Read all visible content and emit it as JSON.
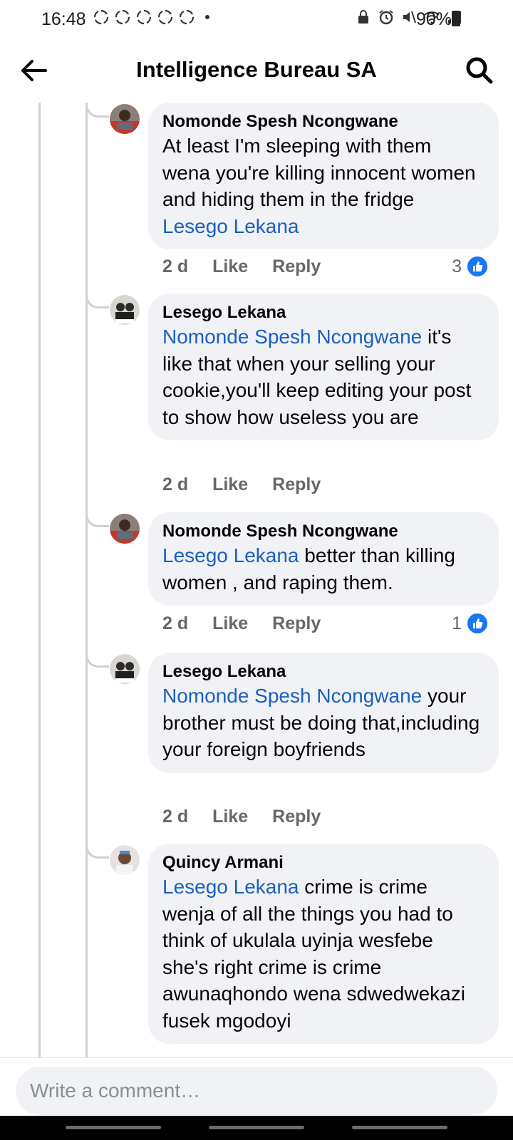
{
  "status_bar": {
    "time": "16:48",
    "battery": "90%"
  },
  "header": {
    "title": "Intelligence Bureau SA"
  },
  "comments": [
    {
      "author": "Nomonde Spesh Ncongwane",
      "text_before": "At least I'm sleeping with them wena you're killing innocent women and hiding them in the fridge ",
      "mention": "Lesego Lekana",
      "text_after": "",
      "time": "2 d",
      "like_label": "Like",
      "reply_label": "Reply",
      "reaction_count": "3"
    },
    {
      "author": "Lesego Lekana",
      "text_before": "",
      "mention": "Nomonde Spesh Ncongwane",
      "text_after": " it's like that when your selling your cookie,you'll keep editing your post to show how useless you are",
      "time": "2 d",
      "like_label": "Like",
      "reply_label": "Reply",
      "reaction_count": ""
    },
    {
      "author": "Nomonde Spesh Ncongwane",
      "text_before": "",
      "mention": "Lesego Lekana",
      "text_after": " better than killing women , and raping them.",
      "time": "2 d",
      "like_label": "Like",
      "reply_label": "Reply",
      "reaction_count": "1"
    },
    {
      "author": "Lesego Lekana",
      "text_before": "",
      "mention": "Nomonde Spesh Ncongwane",
      "text_after": " your brother must be doing that,including your foreign boyfriends",
      "time": "2 d",
      "like_label": "Like",
      "reply_label": "Reply",
      "reaction_count": ""
    },
    {
      "author": "Quincy Armani",
      "text_before": "",
      "mention": "Lesego Lekana",
      "text_after": " crime is crime wenja of all the things you had to think of ukulala uyinja wesfebe she's right crime is crime awunaqhondo wena sdwedwekazi fusek mgodoyi",
      "time": "",
      "like_label": "",
      "reply_label": "",
      "reaction_count": ""
    }
  ],
  "composer": {
    "placeholder": "Write a comment…"
  },
  "colors": {
    "mention": "#1b5fc1",
    "bubble": "#f0f2f5",
    "like_blue": "#1877f2",
    "meta_gray": "#65676b"
  }
}
